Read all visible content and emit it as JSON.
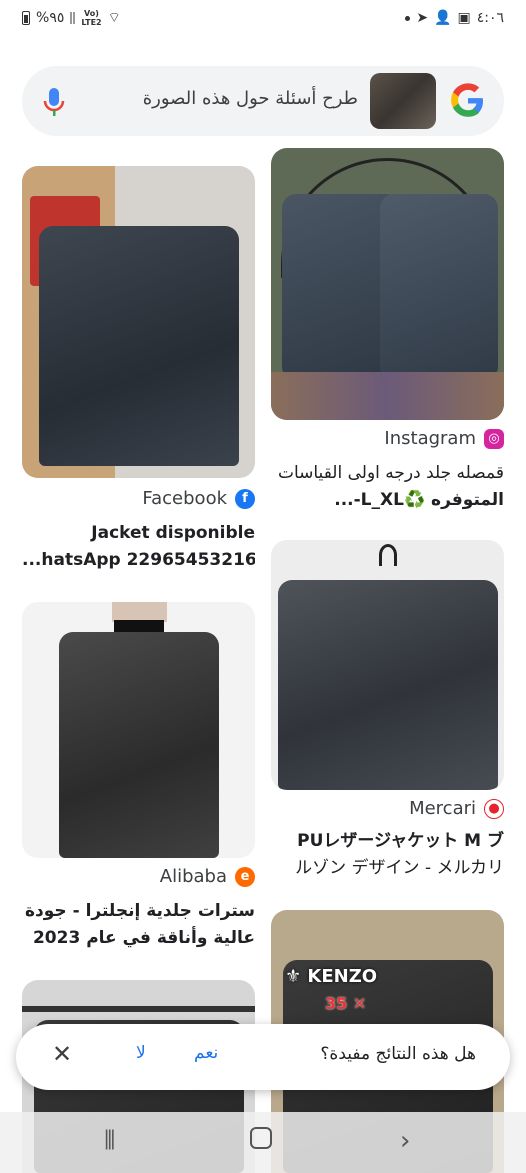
{
  "status_bar": {
    "time": "٤:٠٦",
    "battery": "%٩٥",
    "network": "Vo) LTE2"
  },
  "search": {
    "placeholder": "طرح أسئلة حول هذه الصورة",
    "logo": "google-logo",
    "mic_icon": "mic-icon"
  },
  "results": [
    {
      "source": "Facebook",
      "title_line1": "Jacket disponible",
      "title_line2": "...hatsApp 22965453216",
      "icon": "facebook-icon"
    },
    {
      "source": "Instagram",
      "title_line1": "قمصله جلد درجه اولى القياسات",
      "title_line2": "المتوفره ♻️L_XL-...",
      "icon": "instagram-icon"
    },
    {
      "source": "Alibaba",
      "title_line1": "سترات جلدية إنجلترا - جودة",
      "title_line2": "عالية وأناقة في عام 2023",
      "icon": "alibaba-icon"
    },
    {
      "source": "Mercari",
      "title_line1": "PUレザージャケット M ブ",
      "title_line2": "ルゾン デザイン - メルカリ",
      "icon": "mercari-icon"
    }
  ],
  "kenzo_overlay": {
    "brand": "KENZO",
    "price": "35"
  },
  "feedback": {
    "question": "هل هذه النتائج مفيدة؟",
    "yes": "نعم",
    "no": "لا"
  },
  "colors": {
    "accent": "#1a73e8",
    "search_bg": "#f1f3f4",
    "facebook": "#1877f2",
    "instagram": "#d6249f",
    "alibaba": "#ff6a00",
    "mercari": "#e3262d"
  }
}
